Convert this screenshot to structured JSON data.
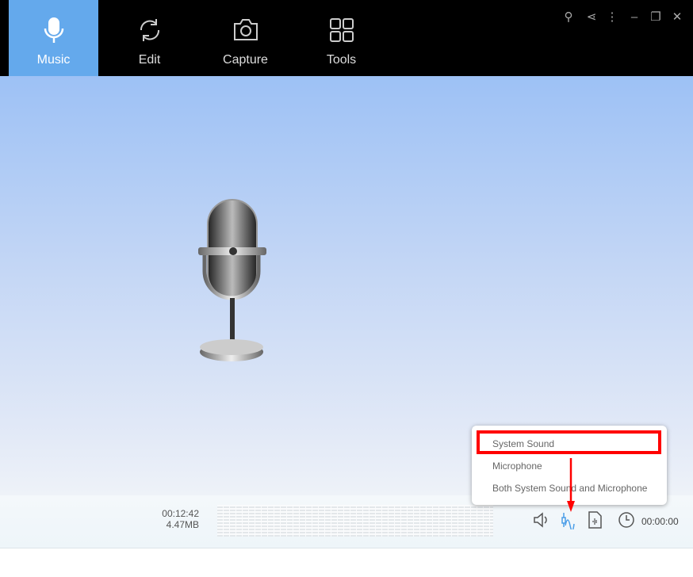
{
  "tabs": [
    {
      "label": "Music",
      "icon": "microphone-icon",
      "active": true
    },
    {
      "label": "Edit",
      "icon": "refresh-icon"
    },
    {
      "label": "Capture",
      "icon": "camera-icon"
    },
    {
      "label": "Tools",
      "icon": "tools-grid-icon"
    }
  ],
  "window_controls": [
    "key-icon",
    "share-icon",
    "more-icon",
    "minimize-icon",
    "restore-icon",
    "close-icon"
  ],
  "colors": {
    "accent": "#64a9ec",
    "highlight": "#ff0000",
    "active_icon": "#4a9de8"
  },
  "status": {
    "duration": "00:12:42",
    "size": "4.47MB",
    "timer": "00:00:00"
  },
  "audio_source_menu": {
    "options": [
      "System Sound",
      "Microphone",
      "Both System Sound and Microphone"
    ],
    "highlighted": "System Sound"
  }
}
